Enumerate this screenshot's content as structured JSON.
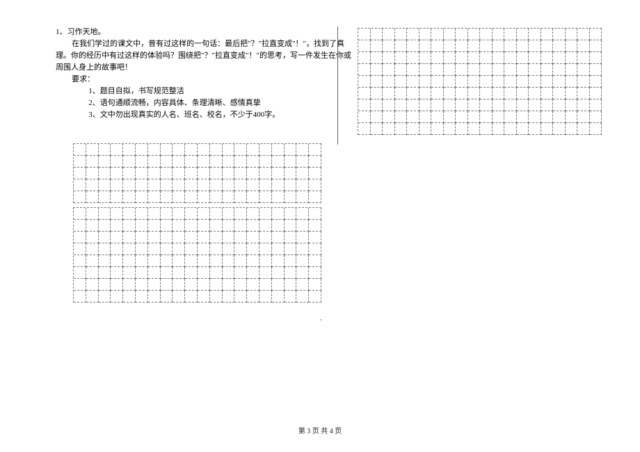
{
  "prompt": {
    "title": "1、习作天地。",
    "para1": "在我们学过的课文中，曾有过这样的一句话：最后把\"？\"拉直变成\"！\"，找到了真",
    "para2": "理。你的经历中有过这样的体验吗？围绕把\"？\"拉直变成\"！\"的思考，写一件发生在你或",
    "para3": "周围人身上的故事吧！",
    "req_label": "要求：",
    "req1": "1、题目自拟，书写规范整洁",
    "req2": "2、语句通顺流畅，内容具体、条理清晰、感情真挚",
    "req3": "3、文中勿出现真实的人名、班名、校名，不少于400字。"
  },
  "grids": {
    "g1": {
      "rows": 9,
      "cols": 20
    },
    "g2": {
      "rows": 5,
      "cols": 20
    },
    "g3": {
      "rows": 8,
      "cols": 20
    }
  },
  "stray": ",",
  "footer": "第 3 页 共 4 页"
}
